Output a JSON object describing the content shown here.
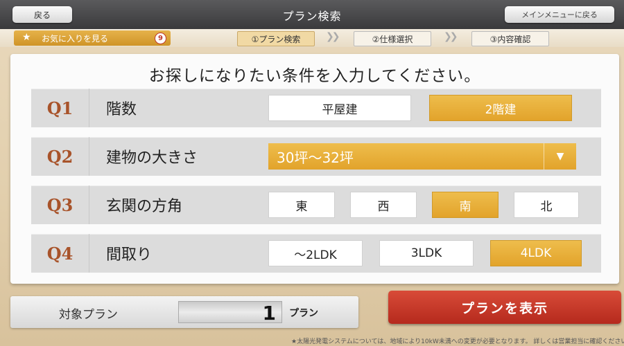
{
  "header": {
    "title": "プラン検索",
    "back_label": "戻る",
    "main_menu_label": "メインメニューに戻る"
  },
  "stepbar": {
    "favorites_label": "お気に入りを見る",
    "favorites_count": "9",
    "steps": [
      {
        "label": "①プラン検索",
        "active": true
      },
      {
        "label": "②仕様選択",
        "active": false
      },
      {
        "label": "③内容確認",
        "active": false
      }
    ]
  },
  "main": {
    "heading": "お探しになりたい条件を入力してください。",
    "questions": [
      {
        "num": "Q1",
        "label": "階数",
        "options": [
          "平屋建",
          "2階建"
        ],
        "selected": "2階建"
      },
      {
        "num": "Q2",
        "label": "建物の大きさ",
        "select_value": "30坪〜32坪"
      },
      {
        "num": "Q3",
        "label": "玄関の方角",
        "options": [
          "東",
          "西",
          "南",
          "北"
        ],
        "selected": "南"
      },
      {
        "num": "Q4",
        "label": "間取り",
        "options": [
          "〜2LDK",
          "3LDK",
          "4LDK"
        ],
        "selected": "4LDK"
      }
    ]
  },
  "footer": {
    "target_label": "対象プラン",
    "count": "1",
    "count_unit": "プラン",
    "show_button_label": "プランを表示",
    "footnote": "★太陽光発電システムについては、地域により10kW未満への変更が必要となります。 詳しくは営業担当に確認ください。"
  },
  "colors": {
    "accent": "#e6ab35",
    "action_red": "#c63a2a",
    "question_number": "#a8532a"
  },
  "icons": {
    "favorite": "star-icon",
    "dropdown": "triangle-down-icon",
    "step_separator": "double-chevron-right-icon"
  }
}
